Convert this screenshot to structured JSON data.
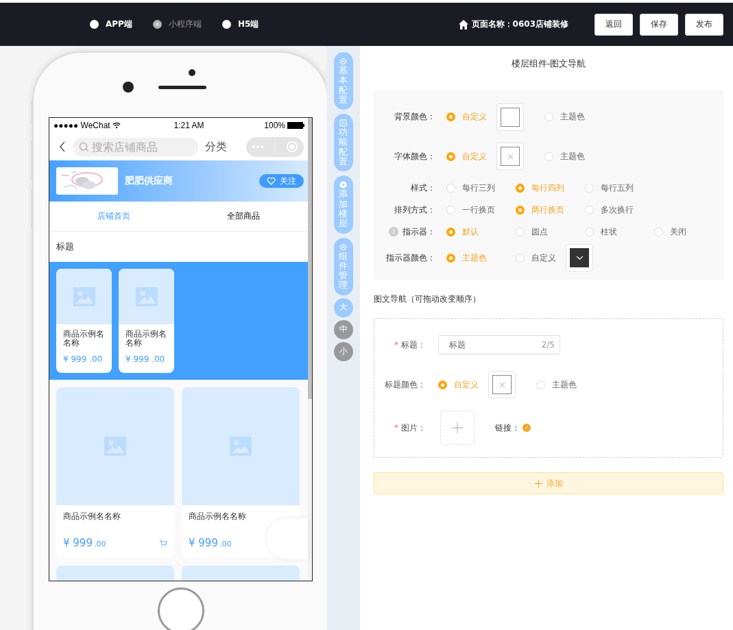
{
  "topbar": {
    "platforms": [
      {
        "label": "APP端",
        "selected": false
      },
      {
        "label": "小程序端",
        "selected": true
      },
      {
        "label": "H5端",
        "selected": false
      }
    ],
    "page_name": "页面名称：0603店铺装修",
    "buttons": [
      "返回",
      "保存",
      "发布"
    ]
  },
  "phone": {
    "status": {
      "carrier": "●●●●● WeChat",
      "time": "1:21 AM",
      "battery": "100%"
    },
    "search": {
      "placeholder": "搜索店铺商品"
    },
    "category": "分类",
    "store": {
      "name": "肥肥供应商",
      "follow": "关注"
    },
    "tabs": [
      {
        "label": "店铺首页",
        "selected": true
      },
      {
        "label": "全部商品",
        "selected": false
      }
    ],
    "section_title": "标题",
    "nav_items": [
      {
        "name": "商品示例名名称",
        "price": "¥ 999",
        "cents": ".00"
      },
      {
        "name": "商品示例名名称",
        "price": "¥ 999",
        "cents": ".00"
      }
    ],
    "products": [
      {
        "name": "商品示例名名称",
        "price": "¥ 999",
        "cents": ".00",
        "cart": true
      },
      {
        "name": "商品示例名名称",
        "price": "¥ 999",
        "cents": ".00",
        "cart": false
      }
    ]
  },
  "side_tabs": [
    "基本配置",
    "功能配置",
    "添加楼层",
    "组件管理"
  ],
  "sizes": [
    {
      "label": "大",
      "selected": true
    },
    {
      "label": "中",
      "selected": false
    },
    {
      "label": "小",
      "selected": false
    }
  ],
  "panel": {
    "title": "楼层组件-图文导航",
    "settings": [
      {
        "label": "背景颜色：",
        "options": [
          {
            "kind": "radio",
            "label": "自定义",
            "selected": true
          },
          {
            "kind": "swatch"
          },
          {
            "kind": "radio",
            "label": "主题色",
            "selected": false
          }
        ]
      },
      {
        "label": "字体颜色：",
        "options": [
          {
            "kind": "radio",
            "label": "自定义",
            "selected": true
          },
          {
            "kind": "swatch"
          },
          {
            "kind": "radio",
            "label": "主题色",
            "selected": false
          }
        ]
      },
      {
        "label": "样式：",
        "options": [
          {
            "kind": "radio",
            "label": "每行三列",
            "selected": false
          },
          {
            "kind": "radio",
            "label": "每行四列",
            "selected": true
          },
          {
            "kind": "radio",
            "label": "每行五列",
            "selected": false
          }
        ]
      },
      {
        "label": "排列方式：",
        "options": [
          {
            "kind": "radio",
            "label": "一行换页",
            "selected": false
          },
          {
            "kind": "radio",
            "label": "两行换页",
            "selected": true
          },
          {
            "kind": "radio",
            "label": "多次换行",
            "selected": false
          }
        ]
      },
      {
        "label": "指示器：",
        "help": "?",
        "options": [
          {
            "kind": "radio",
            "label": "默认",
            "selected": true
          },
          {
            "kind": "radio",
            "label": "圆点",
            "selected": false
          },
          {
            "kind": "radio",
            "label": "柱状",
            "selected": false
          },
          {
            "kind": "radio",
            "label": "关闭",
            "selected": false
          }
        ]
      },
      {
        "label": "指示器颜色：",
        "options": [
          {
            "kind": "radio",
            "label": "主题色",
            "selected": true
          },
          {
            "kind": "radio",
            "label": "自定义",
            "selected": false
          },
          {
            "kind": "swatch"
          }
        ]
      }
    ],
    "nav_heading": "图文导航（可拖动改变顺序）",
    "editor": {
      "title_mark": "*",
      "title_label": "标题：",
      "title_value": "标题",
      "title_count": "2/5",
      "color_label": "标题颜色：",
      "color_options": [
        {
          "kind": "radio",
          "label": "自定义",
          "selected": true
        },
        {
          "kind": "swatch"
        },
        {
          "kind": "radio",
          "label": "主题色",
          "selected": false
        }
      ],
      "image_mark": "*",
      "image_label": "图片：",
      "link_label": "链接："
    },
    "add_button": "添加"
  }
}
